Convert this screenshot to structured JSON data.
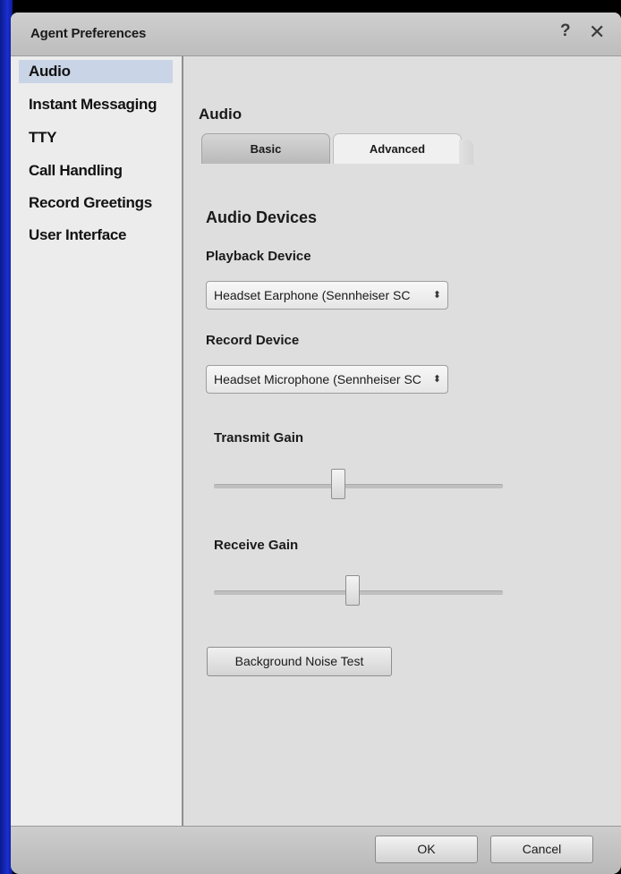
{
  "window": {
    "title": "Agent Preferences",
    "help_label": "?",
    "close_label": "✕"
  },
  "sidebar": {
    "items": [
      {
        "label": "Audio",
        "selected": true
      },
      {
        "label": "Instant Messaging",
        "selected": false
      },
      {
        "label": "TTY",
        "selected": false
      },
      {
        "label": "Call Handling",
        "selected": false
      },
      {
        "label": "Record Greetings",
        "selected": false
      },
      {
        "label": "User Interface",
        "selected": false
      }
    ]
  },
  "content": {
    "section_title": "Audio",
    "tabs": [
      {
        "label": "Basic",
        "active": false
      },
      {
        "label": "Advanced",
        "active": true
      }
    ],
    "group_title": "Audio Devices",
    "playback": {
      "label": "Playback Device",
      "selected_value": "Headset Earphone (Sennheiser SC"
    },
    "record": {
      "label": "Record Device",
      "selected_value": "Headset Microphone (Sennheiser SC"
    },
    "transmit_gain": {
      "label": "Transmit Gain",
      "value_fraction": 0.43
    },
    "receive_gain": {
      "label": "Receive Gain",
      "value_fraction": 0.48
    },
    "noise_test_label": "Background Noise Test"
  },
  "footer": {
    "ok_label": "OK",
    "cancel_label": "Cancel"
  },
  "icons": {
    "select_arrow": "up-down-chevron-icon",
    "close": "close-icon",
    "help": "help-icon"
  }
}
